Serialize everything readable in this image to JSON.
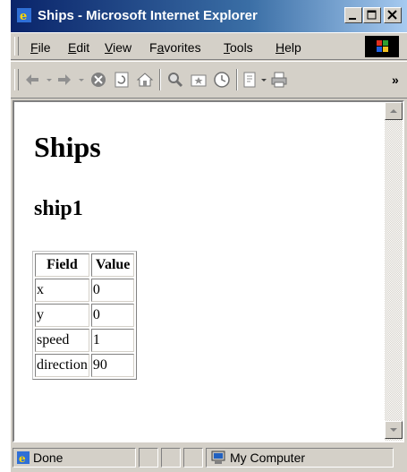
{
  "window": {
    "title": "Ships - Microsoft Internet Explorer"
  },
  "menu": {
    "items": [
      {
        "label": "File",
        "mnemonic": "F"
      },
      {
        "label": "Edit",
        "mnemonic": "E"
      },
      {
        "label": "View",
        "mnemonic": "V"
      },
      {
        "label": "Favorites",
        "mnemonic": "a"
      },
      {
        "label": "Tools",
        "mnemonic": "T"
      },
      {
        "label": "Help",
        "mnemonic": "H"
      }
    ]
  },
  "toolbar": {
    "buttons": [
      {
        "icon": "back-arrow-icon"
      },
      {
        "icon": "forward-arrow-icon"
      },
      {
        "icon": "stop-icon"
      },
      {
        "icon": "refresh-icon"
      },
      {
        "icon": "home-icon"
      },
      {
        "icon": "search-icon"
      },
      {
        "icon": "favorites-icon"
      },
      {
        "icon": "history-icon"
      },
      {
        "icon": "edit-icon"
      },
      {
        "icon": "print-icon"
      }
    ],
    "overflow": "»"
  },
  "page": {
    "heading": "Ships",
    "subheading": "ship1",
    "table": {
      "headers": [
        "Field",
        "Value"
      ],
      "rows": [
        [
          "x",
          "0"
        ],
        [
          "y",
          "0"
        ],
        [
          "speed",
          "1"
        ],
        [
          "direction",
          "90"
        ]
      ]
    }
  },
  "status": {
    "text": "Done",
    "zone": "My Computer"
  },
  "colors": {
    "title_gradient_start": "#0a246a",
    "title_gradient_end": "#a6caf0",
    "chrome": "#d4d0c8"
  }
}
